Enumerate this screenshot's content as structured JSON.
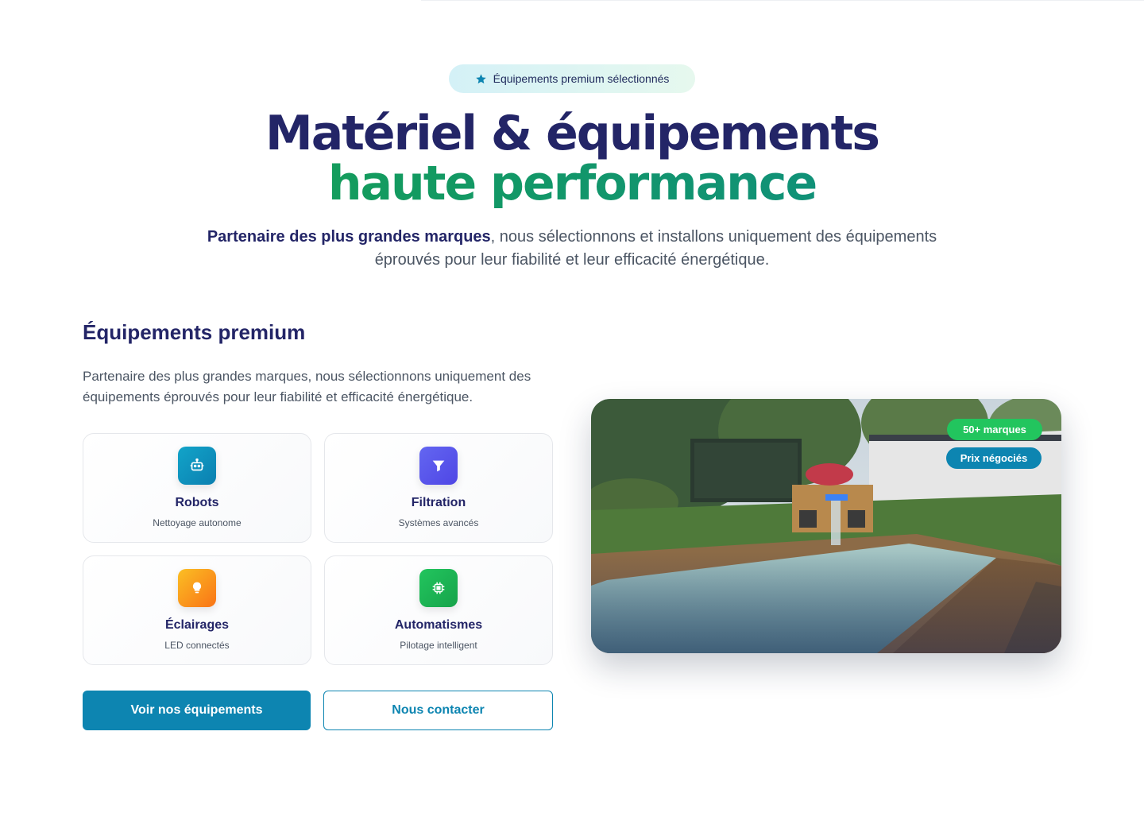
{
  "colors": {
    "navy": "#232567",
    "green": "#16a34a",
    "teal": "#0e8a8a",
    "primary_blue": "#0d85b1",
    "chip_green": "#22c55e"
  },
  "badge": {
    "icon": "star-icon",
    "text": "Équipements premium sélectionnés"
  },
  "hero": {
    "title_line1": "Matériel & équipements",
    "title_line2": "haute performance",
    "desc_strong": "Partenaire des plus grandes marques",
    "desc_rest": ", nous sélectionnons et installons uniquement des équipements éprouvés pour leur fiabilité et leur efficacité énergétique."
  },
  "section": {
    "title": "Équipements premium",
    "desc": "Partenaire des plus grandes marques, nous sélectionnons uniquement des équipements éprouvés pour leur fiabilité et efficacité énergétique."
  },
  "cards": [
    {
      "icon": "robot-icon",
      "title": "Robots",
      "subtitle": "Nettoyage autonome",
      "color": "#0d85b1"
    },
    {
      "icon": "filter-icon",
      "title": "Filtration",
      "subtitle": "Systèmes avancés",
      "color": "#5b57e8"
    },
    {
      "icon": "lightbulb-icon",
      "title": "Éclairages",
      "subtitle": "LED connectés",
      "color": "#f59e0b"
    },
    {
      "icon": "chip-icon",
      "title": "Automatismes",
      "subtitle": "Pilotage intelligent",
      "color": "#16a34a"
    }
  ],
  "buttons": {
    "primary": "Voir nos équipements",
    "secondary": "Nous contacter"
  },
  "photo": {
    "chips": [
      "50+ marques",
      "Prix négociés"
    ]
  }
}
